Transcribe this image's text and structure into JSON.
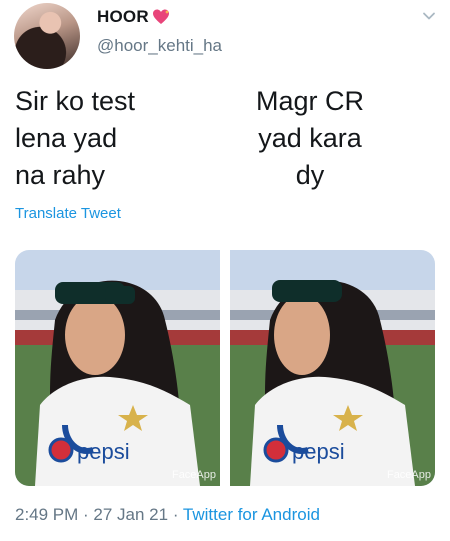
{
  "author": {
    "display_name": "HOOR",
    "emoji": "sparkling-heart-emoji",
    "handle": "@hoor_kehti_ha"
  },
  "tweet": {
    "text_left": "Sir ko test\nlena yad\nna rahy",
    "text_right": "Magr CR\nyad kara\ndy",
    "translate_label": "Translate Tweet"
  },
  "media": {
    "left_watermark": "FaceApp",
    "right_watermark": "FaceApp",
    "left_shirt_brand": "pepsi",
    "right_shirt_brand": "pepsi"
  },
  "meta": {
    "time": "2:49 PM",
    "separator1": " · ",
    "date": "27 Jan 21",
    "separator2": " · ",
    "source": "Twitter for Android"
  },
  "colors": {
    "link": "#1b95e0",
    "secondary": "#657786"
  }
}
